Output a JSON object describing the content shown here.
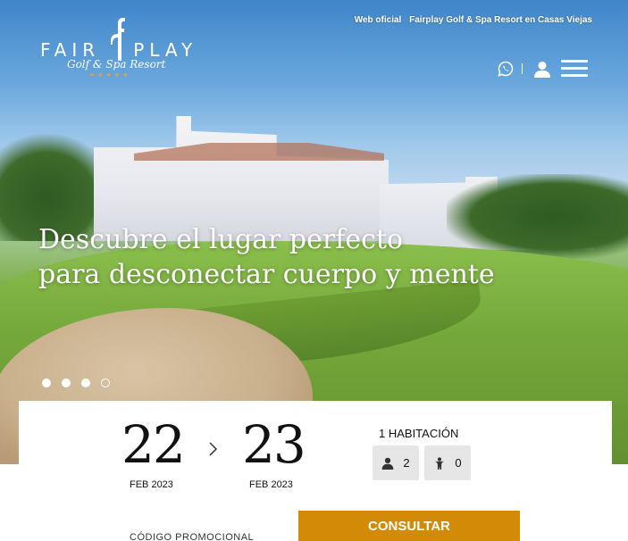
{
  "topbar": {
    "prefix": "Web oficial",
    "text": "Fairplay Golf & Spa Resort en Casas Viejas"
  },
  "logo": {
    "word": "FAIRPLAY",
    "subtitle": "Golf & Spa Resort",
    "stars": "★★★★★"
  },
  "header_icons": {
    "whatsapp": "whatsapp-icon",
    "user": "user-icon",
    "menu": "menu-icon"
  },
  "hero": {
    "line1": "Descubre el lugar perfecto",
    "line2": "para desconectar cuerpo y mente",
    "slides_total": 4,
    "slide_active": 4
  },
  "booking": {
    "checkin": {
      "day": "22",
      "month": "FEB 2023"
    },
    "checkout": {
      "day": "23",
      "month": "FEB 2023"
    },
    "rooms_label": "1 HABITACIÓN",
    "adults": "2",
    "children": "0",
    "promo_label": "CÓDIGO PROMOCIONAL",
    "submit_label": "CONSULTAR"
  },
  "colors": {
    "accent": "#d28a07",
    "stars": "#e2a13a",
    "counter_bg": "#e6e6e6"
  }
}
